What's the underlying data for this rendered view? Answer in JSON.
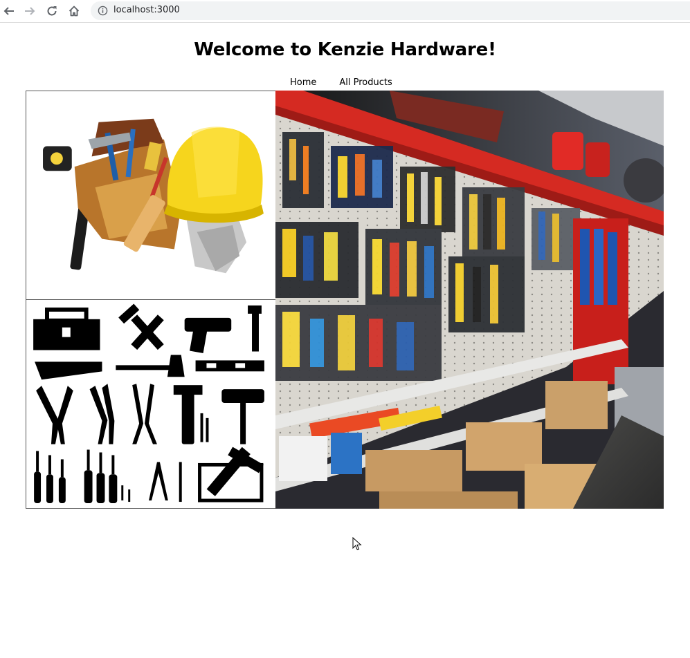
{
  "browser": {
    "url": "localhost:3000",
    "icons": {
      "back": "arrow-left-icon",
      "forward": "arrow-right-icon",
      "reload": "reload-icon",
      "home": "home-icon",
      "site_info": "info-circle-icon"
    }
  },
  "page": {
    "title": "Welcome to Kenzie Hardware!",
    "nav": {
      "home_label": "Home",
      "all_products_label": "All Products"
    }
  },
  "images": {
    "belt": "tool-belt-and-hard-hat-photo",
    "icons": "hand-tools-icon-collage",
    "store": "hardware-store-aisle-photo"
  }
}
